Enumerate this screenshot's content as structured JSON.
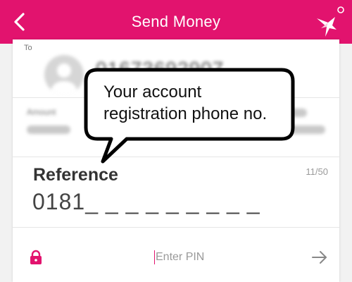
{
  "appbar": {
    "title": "Send Money",
    "back_icon": "chevron-left-icon",
    "logo_icon": "bird-logo-icon",
    "color": "#e2136e"
  },
  "recipient": {
    "to_label": "To",
    "number": "01673692907"
  },
  "amount": {
    "label": "Amount"
  },
  "reference": {
    "label": "Reference",
    "value": "0181_ _ _ _ _ _ _ _ _",
    "counter": "11/50"
  },
  "pin": {
    "placeholder": "Enter PIN",
    "lock_icon": "lock-icon",
    "submit_icon": "arrow-right-icon"
  },
  "callout": {
    "text_line1": "Your account",
    "text_line2": "registration phone no."
  }
}
